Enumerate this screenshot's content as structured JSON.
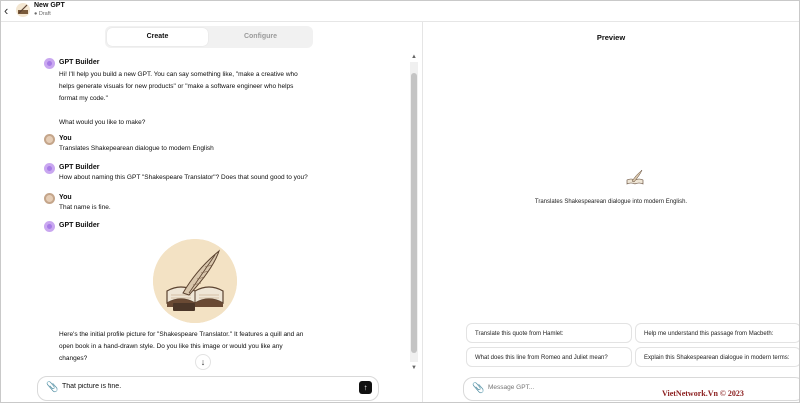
{
  "header": {
    "title": "New GPT",
    "status": "Draft"
  },
  "tabs": [
    {
      "label": "Create",
      "active": true
    },
    {
      "label": "Configure",
      "active": false
    }
  ],
  "conversation": [
    {
      "author": "GPT Builder",
      "role": "bot",
      "text": "Hi! I'll help you build a new GPT. You can say something like, \"make a creative who\nhelps generate visuals for new products\" or \"make a software engineer who helps\nformat my code.\"\n\nWhat would you like to make?"
    },
    {
      "author": "You",
      "role": "user",
      "text": "Translates Shakepearean dialogue to modern English"
    },
    {
      "author": "GPT Builder",
      "role": "bot",
      "text": "How about naming this GPT \"Shakespeare Translator\"? Does that sound good to you?"
    },
    {
      "author": "You",
      "role": "user",
      "text": "That name is fine."
    },
    {
      "author": "GPT Builder",
      "role": "bot",
      "text": "Here's the initial profile picture for \"Shakespeare Translator.\" It features a quill and an\nopen book in a hand-drawn style. Do you like this image or would you like any\nchanges?"
    }
  ],
  "composer": {
    "value": "That picture is fine."
  },
  "preview": {
    "title": "Preview",
    "description": "Translates Shakespearean dialogue into modern English.",
    "suggestions": [
      "Translate this quote from Hamlet:",
      "Help me understand this passage from Macbeth:",
      "What does this line from Romeo and Juliet mean?",
      "Explain this Shakespearean dialogue in modern terms:"
    ],
    "placeholder": "Message GPT..."
  },
  "watermark": "VietNetwork.Vn © 2023",
  "colors": {
    "accent_bot": "#c9a7f0",
    "send_button": "#111111"
  },
  "icons": [
    "back-arrow-icon",
    "attach-paperclip-icon",
    "send-arrow-icon",
    "scroll-down-arrow-icon",
    "quill-book-icon"
  ]
}
